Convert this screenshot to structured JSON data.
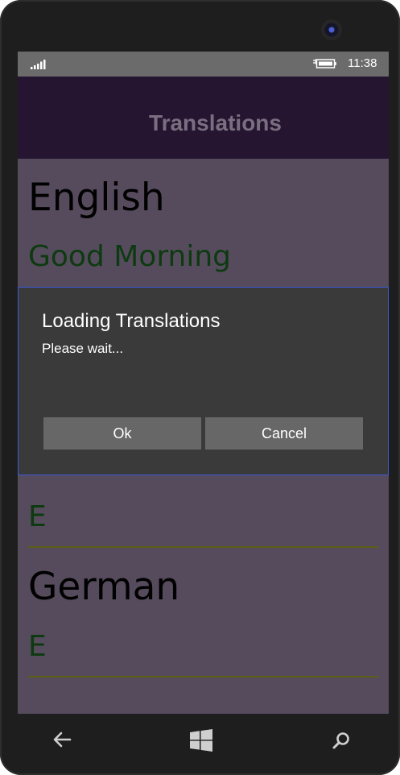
{
  "status_bar": {
    "signal_icon": "signal-bars-icon",
    "battery_icon": "battery-charging-icon",
    "time": "11:38"
  },
  "header": {
    "title": "Translations"
  },
  "content": {
    "source_language": "English",
    "source_phrase": "Good Morning",
    "translation_entry_1": "E",
    "target_language": "German",
    "translation_entry_2": "E"
  },
  "dialog": {
    "title": "Loading Translations",
    "message": "Please wait...",
    "ok_label": "Ok",
    "cancel_label": "Cancel"
  },
  "nav": {
    "back_icon": "back-arrow-icon",
    "home_icon": "windows-logo-icon",
    "search_icon": "search-icon"
  },
  "colors": {
    "screen_bg": "#564b5d",
    "titlebar_bg": "#251530",
    "phrase_color": "#0d3a10",
    "dialog_bg": "#3a3a3a",
    "dialog_border": "#3d5bd6",
    "button_bg": "#676767"
  }
}
